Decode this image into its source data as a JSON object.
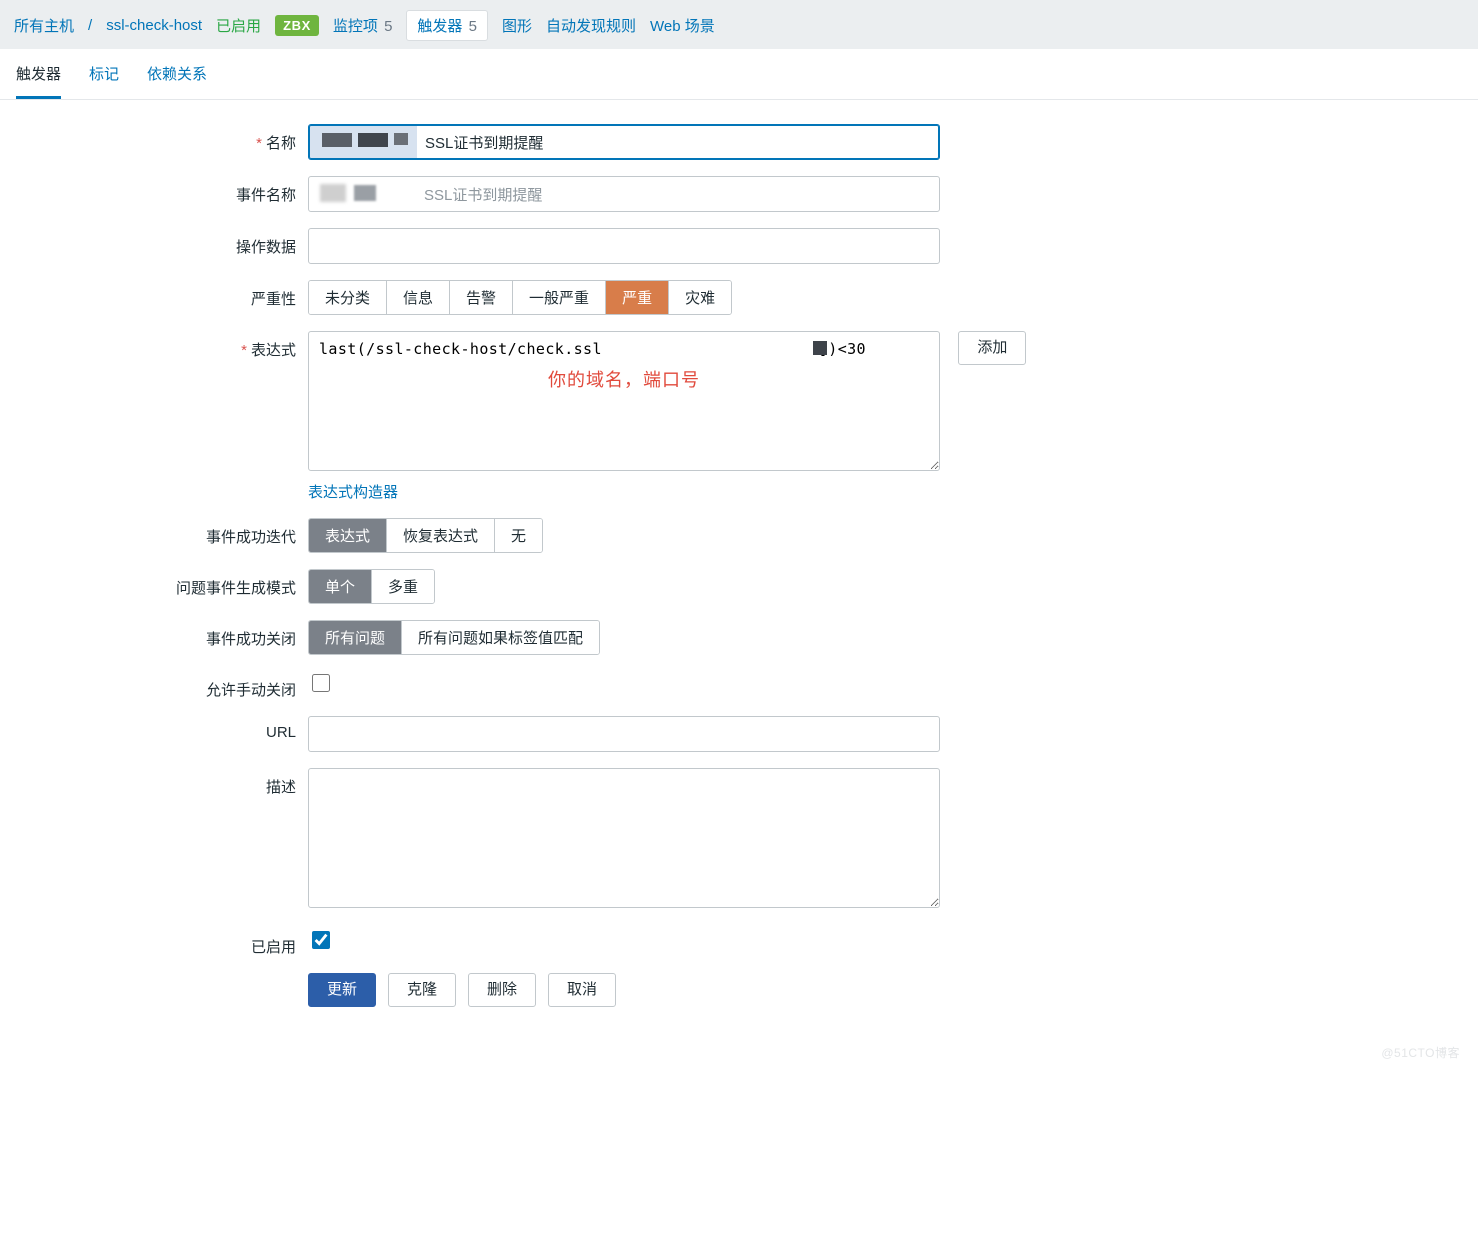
{
  "topbar": {
    "all_hosts": "所有主机",
    "separator": "/",
    "host": "ssl-check-host",
    "enabled": "已启用",
    "zbx": "ZBX",
    "items": {
      "label": "监控项",
      "count": "5"
    },
    "triggers": {
      "label": "触发器",
      "count": "5"
    },
    "graphs": "图形",
    "discovery": "自动发现规则",
    "web": "Web 场景"
  },
  "tabs": {
    "trigger": "触发器",
    "tags": "标记",
    "deps": "依赖关系"
  },
  "labels": {
    "name": "名称",
    "event_name": "事件名称",
    "op_data": "操作数据",
    "severity": "严重性",
    "expression": "表达式",
    "add": "添加",
    "exp_builder": "表达式构造器",
    "ok_iter": "事件成功迭代",
    "gen_mode": "问题事件生成模式",
    "ok_close": "事件成功关闭",
    "manual_close": "允许手动关闭",
    "url": "URL",
    "desc": "描述",
    "enabled": "已启用"
  },
  "overlay": {
    "hint": "你的域名，端口号"
  },
  "fields": {
    "name": "SSL证书到期提醒",
    "event_placeholder": "SSL证书到期提醒",
    "op_data": "",
    "expression": "last(/ssl-check-host/check.ssl                       ])<30",
    "url": "",
    "desc": "",
    "manual_close": false,
    "enabled": true
  },
  "severity": {
    "options": [
      "未分类",
      "信息",
      "告警",
      "一般严重",
      "严重",
      "灾难"
    ],
    "selected": 4
  },
  "ok_iter": {
    "options": [
      "表达式",
      "恢复表达式",
      "无"
    ],
    "selected": 0
  },
  "gen_mode": {
    "options": [
      "单个",
      "多重"
    ],
    "selected": 0
  },
  "ok_close": {
    "options": [
      "所有问题",
      "所有问题如果标签值匹配"
    ],
    "selected": 0
  },
  "actions": {
    "update": "更新",
    "clone": "克隆",
    "delete": "删除",
    "cancel": "取消"
  },
  "watermark": "@51CTO博客"
}
